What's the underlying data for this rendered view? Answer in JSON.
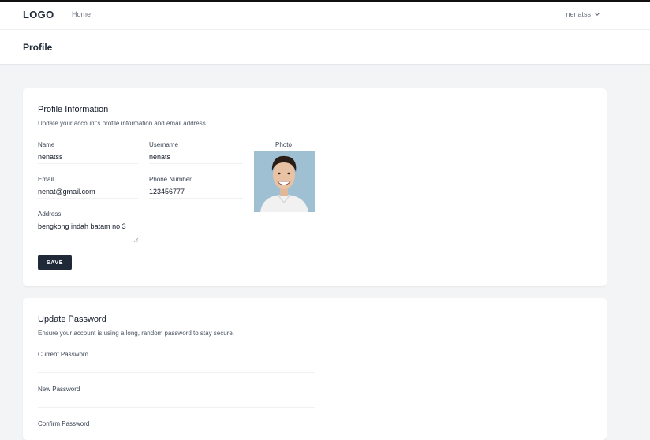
{
  "navbar": {
    "logo": "LOGO",
    "home": "Home",
    "user": "nenatss"
  },
  "header": {
    "title": "Profile"
  },
  "profile": {
    "title": "Profile Information",
    "description": "Update your account's profile information and email address.",
    "name_label": "Name",
    "name_value": "nenatss",
    "username_label": "Username",
    "username_value": "nenats",
    "photo_label": "Photo",
    "email_label": "Email",
    "email_value": "nenat@gmail.com",
    "phone_label": "Phone Number",
    "phone_value": "123456777",
    "address_label": "Address",
    "address_value": "bengkong indah batam no,3",
    "save_label": "SAVE"
  },
  "password": {
    "title": "Update Password",
    "description": "Ensure your account is using a long, random password to stay secure.",
    "current_label": "Current Password",
    "new_label": "New Password",
    "confirm_label": "Confirm Password"
  },
  "icons": {
    "user_menu": "chevron-down-icon",
    "photo": "avatar-photo"
  },
  "colors": {
    "button_bg": "#1f2937",
    "page_bg": "#f3f4f6",
    "card_bg": "#ffffff"
  }
}
